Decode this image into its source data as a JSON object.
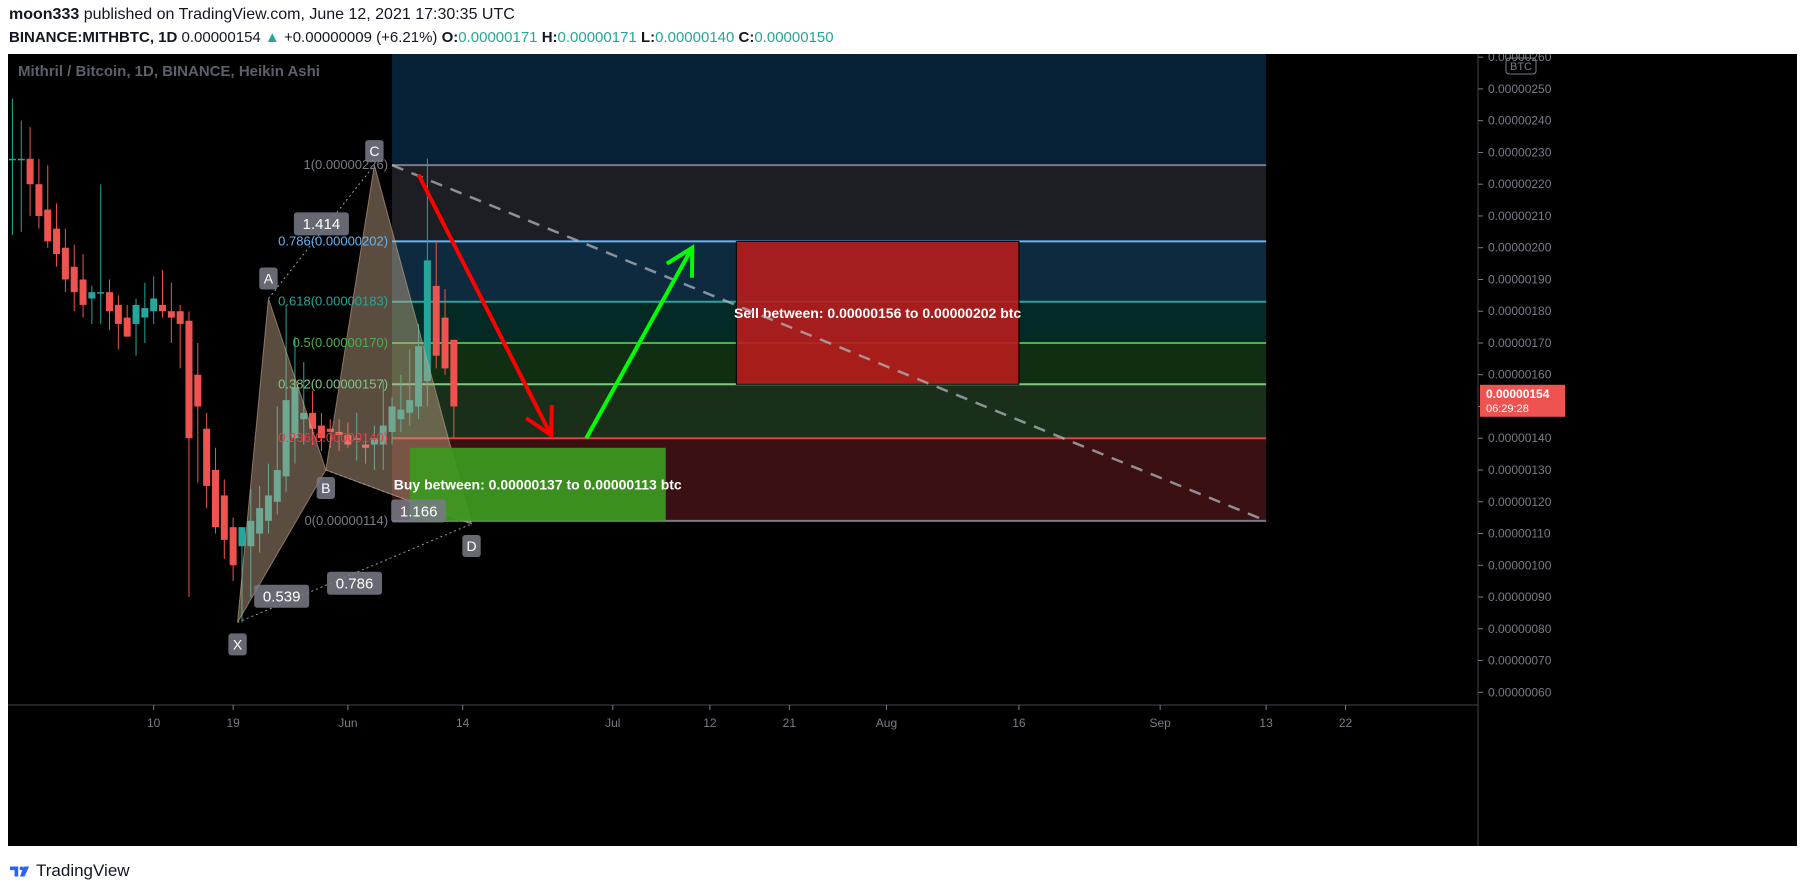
{
  "header": {
    "author": "moon333",
    "published_text": "published on TradingView.com, June 12, 2021 17:30:35 UTC",
    "symbol": "BINANCE:MITHBTC, 1D",
    "last": "0.00000154",
    "change": "+0.00000009 (+6.21%)",
    "o_label": "O:",
    "o": "0.00000171",
    "h_label": "H:",
    "h": "0.00000171",
    "l_label": "L:",
    "l": "0.00000140",
    "c_label": "C:",
    "c": "0.00000150"
  },
  "chart_title": "Mithril / Bitcoin, 1D, BINANCE, Heikin Ashi",
  "footer": {
    "brand": "TradingView"
  },
  "colors": {
    "up": "#26a69a",
    "down": "#ef5350",
    "background": "#000000",
    "sell_box": "#b71c1c",
    "buy_box": "#3c9a1f"
  },
  "chart_data": {
    "type": "candlestick",
    "title": "Mithril / Bitcoin, 1D, BINANCE, Heikin Ashi",
    "price_axis": {
      "unit_label": "BTC",
      "ticks": [
        "0.00000260",
        "0.00000250",
        "0.00000240",
        "0.00000230",
        "0.00000220",
        "0.00000210",
        "0.00000200",
        "0.00000190",
        "0.00000180",
        "0.00000170",
        "0.00000160",
        "0.00000150",
        "0.00000140",
        "0.00000130",
        "0.00000120",
        "0.00000110",
        "0.00000100",
        "0.00000090",
        "0.00000080",
        "0.00000070",
        "0.00000060"
      ],
      "range": [
        5.6e-07,
        2.61e-06
      ],
      "current_price": "0.00000154",
      "countdown": "06:29:28"
    },
    "time_axis": {
      "ticks": [
        {
          "label": "10",
          "day": 8
        },
        {
          "label": "19",
          "day": 17
        },
        {
          "label": "Jun",
          "day": 30
        },
        {
          "label": "14",
          "day": 43
        },
        {
          "label": "Jul",
          "day": 60
        },
        {
          "label": "12",
          "day": 71
        },
        {
          "label": "21",
          "day": 80
        },
        {
          "label": "Aug",
          "day": 91
        },
        {
          "label": "16",
          "day": 106
        },
        {
          "label": "Sep",
          "day": 122
        },
        {
          "label": "13",
          "day": 134
        },
        {
          "label": "22",
          "day": 143
        }
      ],
      "day_range": [
        -8.5,
        158
      ]
    },
    "candles": [
      {
        "o": 228,
        "h": 247,
        "l": 204,
        "c": 228
      },
      {
        "o": 228,
        "h": 240,
        "l": 205,
        "c": 228
      },
      {
        "o": 228,
        "h": 238,
        "l": 210,
        "c": 220
      },
      {
        "o": 220,
        "h": 228,
        "l": 206,
        "c": 210
      },
      {
        "o": 212,
        "h": 226,
        "l": 200,
        "c": 202
      },
      {
        "o": 206,
        "h": 214,
        "l": 194,
        "c": 198
      },
      {
        "o": 200,
        "h": 206,
        "l": 186,
        "c": 190
      },
      {
        "o": 194,
        "h": 201,
        "l": 180,
        "c": 186
      },
      {
        "o": 190,
        "h": 198,
        "l": 178,
        "c": 182
      },
      {
        "o": 184,
        "h": 188,
        "l": 176,
        "c": 186
      },
      {
        "o": 186,
        "h": 220,
        "l": 176,
        "c": 186
      },
      {
        "o": 186,
        "h": 190,
        "l": 174,
        "c": 180
      },
      {
        "o": 182,
        "h": 185,
        "l": 168,
        "c": 176
      },
      {
        "o": 178,
        "h": 182,
        "l": 172,
        "c": 172
      },
      {
        "o": 176,
        "h": 184,
        "l": 166,
        "c": 182
      },
      {
        "o": 178,
        "h": 189,
        "l": 170,
        "c": 181
      },
      {
        "o": 180,
        "h": 191,
        "l": 176,
        "c": 184
      },
      {
        "o": 182,
        "h": 193,
        "l": 178,
        "c": 180
      },
      {
        "o": 180,
        "h": 189,
        "l": 170,
        "c": 178
      },
      {
        "o": 180,
        "h": 182,
        "l": 162,
        "c": 176
      },
      {
        "o": 177,
        "h": 180,
        "l": 90,
        "c": 140
      },
      {
        "o": 160,
        "h": 170,
        "l": 126,
        "c": 150
      },
      {
        "o": 143,
        "h": 148,
        "l": 118,
        "c": 125
      },
      {
        "o": 130,
        "h": 137,
        "l": 110,
        "c": 112
      },
      {
        "o": 122,
        "h": 127,
        "l": 102,
        "c": 108
      },
      {
        "o": 112,
        "h": 115,
        "l": 95,
        "c": 100
      },
      {
        "o": 106,
        "h": 112,
        "l": 82,
        "c": 112
      },
      {
        "o": 106,
        "h": 124,
        "l": 90,
        "c": 114
      },
      {
        "o": 110,
        "h": 125,
        "l": 104,
        "c": 118
      },
      {
        "o": 114,
        "h": 132,
        "l": 110,
        "c": 122
      },
      {
        "o": 120,
        "h": 150,
        "l": 116,
        "c": 130
      },
      {
        "o": 128,
        "h": 182,
        "l": 123,
        "c": 152
      },
      {
        "o": 140,
        "h": 172,
        "l": 132,
        "c": 156
      },
      {
        "o": 146,
        "h": 164,
        "l": 138,
        "c": 148
      },
      {
        "o": 148,
        "h": 155,
        "l": 138,
        "c": 143
      },
      {
        "o": 144,
        "h": 148,
        "l": 136,
        "c": 140
      },
      {
        "o": 143,
        "h": 146,
        "l": 137,
        "c": 142
      },
      {
        "o": 142,
        "h": 146,
        "l": 136,
        "c": 141
      },
      {
        "o": 141,
        "h": 145,
        "l": 137,
        "c": 138
      },
      {
        "o": 140,
        "h": 148,
        "l": 133,
        "c": 140
      },
      {
        "o": 138,
        "h": 141,
        "l": 132,
        "c": 137
      },
      {
        "o": 138,
        "h": 144,
        "l": 130,
        "c": 140
      },
      {
        "o": 138,
        "h": 158,
        "l": 130,
        "c": 144
      },
      {
        "o": 142,
        "h": 153,
        "l": 138,
        "c": 150
      },
      {
        "o": 146,
        "h": 160,
        "l": 142,
        "c": 149
      },
      {
        "o": 148,
        "h": 168,
        "l": 144,
        "c": 152
      },
      {
        "o": 150,
        "h": 176,
        "l": 146,
        "c": 169
      },
      {
        "o": 158,
        "h": 228,
        "l": 150,
        "c": 196
      },
      {
        "o": 188,
        "h": 202,
        "l": 162,
        "c": 166
      },
      {
        "o": 178,
        "h": 187,
        "l": 160,
        "c": 162
      },
      {
        "o": 171,
        "h": 171,
        "l": 140,
        "c": 150
      }
    ],
    "harmonic_pattern": {
      "points": [
        {
          "label": "X",
          "day": 17.5,
          "price": 82
        },
        {
          "label": "A",
          "day": 21,
          "price": 184
        },
        {
          "label": "B",
          "day": 27.5,
          "price": 130
        },
        {
          "label": "C",
          "day": 33,
          "price": 226
        },
        {
          "label": "D",
          "day": 44,
          "price": 113
        }
      ],
      "ratios": [
        "1.414",
        "0.539",
        "0.786",
        "1.166"
      ]
    },
    "fib_levels": [
      {
        "label": "1(0.00000226)",
        "price": 226,
        "color": "#787b86"
      },
      {
        "label": "0.786(0.00000202)",
        "price": 202,
        "color": "#64b5f6"
      },
      {
        "label": "0.618(0.00000183)",
        "price": 183,
        "color": "#26a69a"
      },
      {
        "label": "0.5(0.00000170)",
        "price": 170,
        "color": "#4caf50"
      },
      {
        "label": "0.382(0.00000157)",
        "price": 157,
        "color": "#81c784"
      },
      {
        "label": "0.236(0.00000140)",
        "price": 140,
        "color": "#f23645"
      },
      {
        "label": "0(0.00000114)",
        "price": 114,
        "color": "#787b86"
      }
    ],
    "sell_zone": {
      "text": "Sell between: 0.00000156 to 0.00000202 btc",
      "price_low": 157,
      "price_high": 202,
      "day_start": 74,
      "day_end": 106
    },
    "buy_zone": {
      "text": "Buy between: 0.00000137 to 0.00000113 btc",
      "price_low": 114,
      "price_high": 137,
      "day_start": 37,
      "day_end": 66
    },
    "grid": false
  }
}
